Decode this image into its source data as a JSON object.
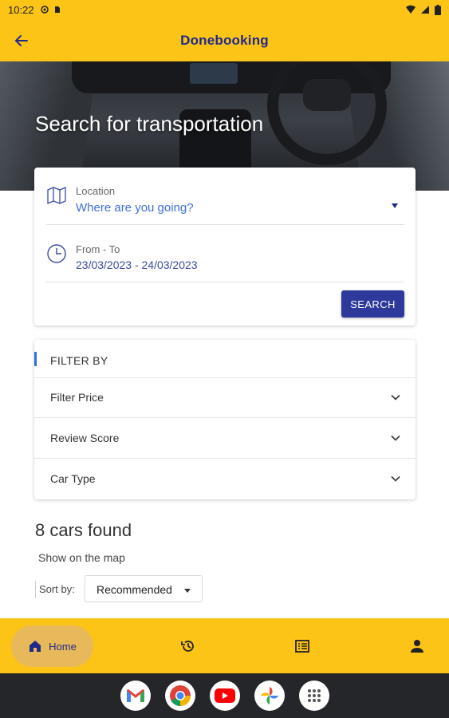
{
  "status_bar": {
    "time": "10:22"
  },
  "app_bar": {
    "title": "Donebooking"
  },
  "hero": {
    "headline": "Search for transportation"
  },
  "search": {
    "location_label": "Location",
    "location_placeholder": "Where are you going?",
    "dates_label": "From - To",
    "dates_value": "23/03/2023 - 24/03/2023",
    "button_label": "SEARCH"
  },
  "filter": {
    "title": "FILTER BY",
    "items": [
      {
        "label": "Filter Price"
      },
      {
        "label": "Review Score"
      },
      {
        "label": "Car Type"
      }
    ]
  },
  "results": {
    "count_text": "8 cars found",
    "map_link": "Show on the map",
    "sort_label": "Sort by:",
    "sort_value": "Recommended"
  },
  "bottom_nav": {
    "home_label": "Home",
    "icons": [
      "home-icon",
      "history-icon",
      "bookings-list-icon",
      "profile-icon"
    ]
  },
  "dock": {
    "apps": [
      "gmail-icon",
      "chrome-icon",
      "youtube-icon",
      "photos-icon",
      "app-drawer-icon"
    ]
  },
  "colors": {
    "brand_yellow": "#fbc417",
    "primary_navy": "#1f2a8a",
    "button_blue": "#2d3a9c",
    "link_blue": "#3e6fd8"
  }
}
